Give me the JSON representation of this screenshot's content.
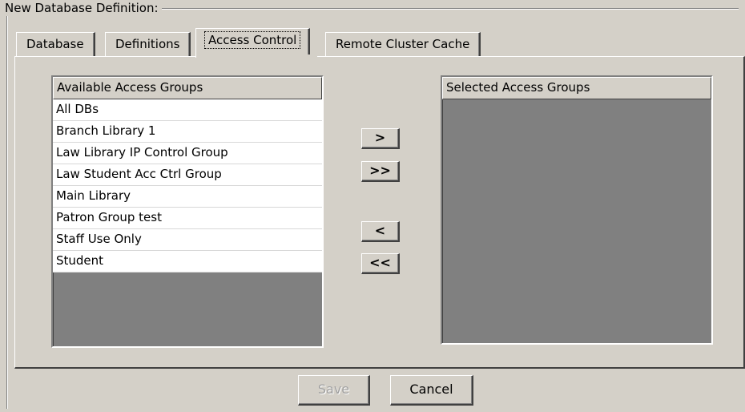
{
  "group": {
    "title": "New Database Definition:"
  },
  "tabs": [
    {
      "label": "Database",
      "active": false
    },
    {
      "label": "Definitions",
      "active": false
    },
    {
      "label": "Access Control",
      "active": true
    },
    {
      "label": "Remote Cluster Cache",
      "active": false
    }
  ],
  "available": {
    "header": "Available Access Groups",
    "items": [
      "All DBs",
      "Branch Library 1",
      "Law Library IP Control Group",
      "Law Student Acc Ctrl Group",
      "Main Library",
      "Patron Group test",
      "Staff Use Only",
      "Student"
    ]
  },
  "selected": {
    "header": "Selected Access Groups",
    "items": []
  },
  "move_buttons": {
    "add_one": ">",
    "add_all": ">>",
    "remove_one": "<",
    "remove_all": "<<"
  },
  "footer": {
    "save_label": "Save",
    "save_enabled": false,
    "cancel_label": "Cancel"
  },
  "colors": {
    "face": "#d4d0c8",
    "empty_list": "#808080",
    "row": "#ffffff",
    "disabled_text": "#a0a0a0"
  }
}
